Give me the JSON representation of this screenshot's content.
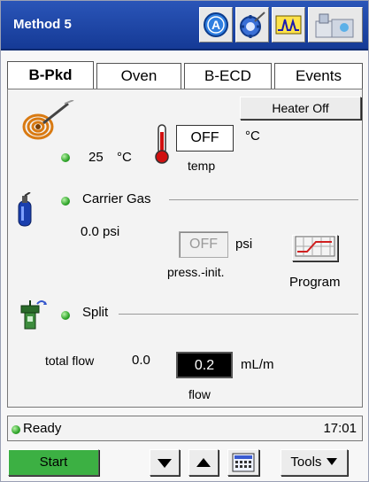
{
  "window": {
    "title": "Method 5"
  },
  "toolbar_icons": [
    "method-a-icon",
    "injector-settings-icon",
    "chromatogram-icon",
    "sampler-icon"
  ],
  "tabs": [
    {
      "label": "B-Pkd",
      "active": true
    },
    {
      "label": "Oven",
      "active": false
    },
    {
      "label": "B-ECD",
      "active": false
    },
    {
      "label": "Events",
      "active": false
    }
  ],
  "heater": {
    "button_label": "Heater Off"
  },
  "temperature": {
    "actual_value": "25",
    "actual_unit": "°C",
    "setpoint_value": "OFF",
    "setpoint_unit": "°C",
    "setpoint_caption": "temp"
  },
  "carrier": {
    "section_label": "Carrier Gas",
    "pressure_value": "0.0 psi",
    "setpoint_value": "OFF",
    "setpoint_unit": "psi",
    "setpoint_caption": "press.-init.",
    "program_label": "Program"
  },
  "split": {
    "section_label": "Split",
    "total_flow_label": "total flow",
    "total_flow_value": "0.0",
    "flow_value": "0.2",
    "flow_unit": "mL/m",
    "flow_caption": "flow"
  },
  "status": {
    "text": "Ready",
    "time": "17:01"
  },
  "bottom": {
    "start_label": "Start",
    "tools_label": "Tools"
  },
  "colors": {
    "titlebar": "#1f4aa8",
    "start_button": "#3cb043",
    "led": "#2fa52a"
  }
}
